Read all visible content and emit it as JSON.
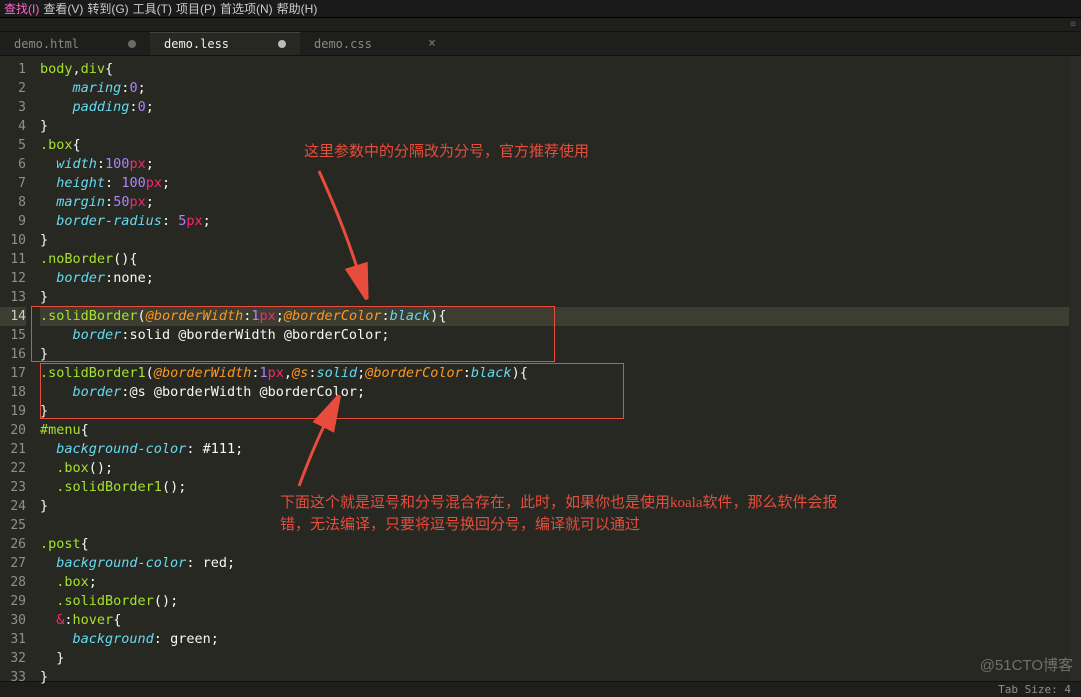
{
  "menubar": {
    "items": [
      "查找(I)",
      "查看(V)",
      "转到(G)",
      "工具(T)",
      "项目(P)",
      "首选项(N)",
      "帮助(H)"
    ]
  },
  "tabs": [
    {
      "label": "demo.html",
      "dirty": true,
      "active": false
    },
    {
      "label": "demo.less",
      "dirty": true,
      "active": true
    },
    {
      "label": "demo.css",
      "active": false,
      "close": true
    }
  ],
  "gutter": {
    "start": 1,
    "end": 33,
    "highlight": 14
  },
  "code": [
    [
      [
        "sel",
        "body"
      ],
      [
        "punct",
        ","
      ],
      [
        "sel",
        "div"
      ],
      [
        "punct",
        "{"
      ]
    ],
    [
      [
        "plain",
        "    "
      ],
      [
        "prop",
        "maring"
      ],
      [
        "punct",
        ":"
      ],
      [
        "num",
        "0"
      ],
      [
        "punct",
        ";"
      ]
    ],
    [
      [
        "plain",
        "    "
      ],
      [
        "prop",
        "padding"
      ],
      [
        "punct",
        ":"
      ],
      [
        "num",
        "0"
      ],
      [
        "punct",
        ";"
      ]
    ],
    [
      [
        "punct",
        "}"
      ]
    ],
    [
      [
        "sel",
        ".box"
      ],
      [
        "punct",
        "{"
      ]
    ],
    [
      [
        "plain",
        "  "
      ],
      [
        "prop",
        "width"
      ],
      [
        "punct",
        ":"
      ],
      [
        "num",
        "100"
      ],
      [
        "unit",
        "px"
      ],
      [
        "punct",
        ";"
      ]
    ],
    [
      [
        "plain",
        "  "
      ],
      [
        "prop",
        "height"
      ],
      [
        "punct",
        ": "
      ],
      [
        "num",
        "100"
      ],
      [
        "unit",
        "px"
      ],
      [
        "punct",
        ";"
      ]
    ],
    [
      [
        "plain",
        "  "
      ],
      [
        "prop",
        "margin"
      ],
      [
        "punct",
        ":"
      ],
      [
        "num",
        "50"
      ],
      [
        "unit",
        "px"
      ],
      [
        "punct",
        ";"
      ]
    ],
    [
      [
        "plain",
        "  "
      ],
      [
        "prop",
        "border-radius"
      ],
      [
        "punct",
        ": "
      ],
      [
        "num",
        "5"
      ],
      [
        "unit",
        "px"
      ],
      [
        "punct",
        ";"
      ]
    ],
    [
      [
        "punct",
        "}"
      ]
    ],
    [
      [
        "sel",
        ".noBorder"
      ],
      [
        "punct",
        "(){"
      ]
    ],
    [
      [
        "plain",
        "  "
      ],
      [
        "prop",
        "border"
      ],
      [
        "punct",
        ":"
      ],
      [
        "plain",
        "none"
      ],
      [
        "punct",
        ";"
      ]
    ],
    [
      [
        "punct",
        "}"
      ]
    ],
    [
      [
        "sel",
        ".solidBorder"
      ],
      [
        "punct",
        "("
      ],
      [
        "param",
        "@borderWidth"
      ],
      [
        "punct",
        ":"
      ],
      [
        "num",
        "1"
      ],
      [
        "unit",
        "px"
      ],
      [
        "punct",
        ";"
      ],
      [
        "param",
        "@borderColor"
      ],
      [
        "punct",
        ":"
      ],
      [
        "str",
        "black"
      ],
      [
        "punct",
        "){"
      ]
    ],
    [
      [
        "plain",
        "    "
      ],
      [
        "prop",
        "border"
      ],
      [
        "punct",
        ":"
      ],
      [
        "plain",
        "solid @borderWidth @borderColor"
      ],
      [
        "punct",
        ";"
      ]
    ],
    [
      [
        "punct",
        "}"
      ]
    ],
    [
      [
        "sel",
        ".solidBorder1"
      ],
      [
        "punct",
        "("
      ],
      [
        "param",
        "@borderWidth"
      ],
      [
        "punct",
        ":"
      ],
      [
        "num",
        "1"
      ],
      [
        "unit",
        "px"
      ],
      [
        "punct",
        ","
      ],
      [
        "param",
        "@s"
      ],
      [
        "punct",
        ":"
      ],
      [
        "str",
        "solid"
      ],
      [
        "punct",
        ";"
      ],
      [
        "param",
        "@borderColor"
      ],
      [
        "punct",
        ":"
      ],
      [
        "str",
        "black"
      ],
      [
        "punct",
        "){"
      ]
    ],
    [
      [
        "plain",
        "    "
      ],
      [
        "prop",
        "border"
      ],
      [
        "punct",
        ":"
      ],
      [
        "plain",
        "@s @borderWidth @borderColor"
      ],
      [
        "punct",
        ";"
      ]
    ],
    [
      [
        "punct",
        "}"
      ]
    ],
    [
      [
        "id",
        "#menu"
      ],
      [
        "punct",
        "{"
      ]
    ],
    [
      [
        "plain",
        "  "
      ],
      [
        "prop",
        "background-color"
      ],
      [
        "punct",
        ": "
      ],
      [
        "plain",
        "#111"
      ],
      [
        "punct",
        ";"
      ]
    ],
    [
      [
        "plain",
        "  "
      ],
      [
        "sel",
        ".box"
      ],
      [
        "punct",
        "();"
      ]
    ],
    [
      [
        "plain",
        "  "
      ],
      [
        "sel",
        ".solidBorder1"
      ],
      [
        "punct",
        "();"
      ]
    ],
    [
      [
        "punct",
        "}"
      ]
    ],
    [],
    [
      [
        "sel",
        ".post"
      ],
      [
        "punct",
        "{"
      ]
    ],
    [
      [
        "plain",
        "  "
      ],
      [
        "prop",
        "background-color"
      ],
      [
        "punct",
        ": "
      ],
      [
        "plain",
        "red"
      ],
      [
        "punct",
        ";"
      ]
    ],
    [
      [
        "plain",
        "  "
      ],
      [
        "sel",
        ".box"
      ],
      [
        "punct",
        ";"
      ]
    ],
    [
      [
        "plain",
        "  "
      ],
      [
        "sel",
        ".solidBorder"
      ],
      [
        "punct",
        "();"
      ]
    ],
    [
      [
        "plain",
        "  "
      ],
      [
        "kw",
        "&"
      ],
      [
        "punct",
        ":"
      ],
      [
        "fn",
        "hover"
      ],
      [
        "punct",
        "{"
      ]
    ],
    [
      [
        "plain",
        "    "
      ],
      [
        "prop",
        "background"
      ],
      [
        "punct",
        ": "
      ],
      [
        "plain",
        "green"
      ],
      [
        "punct",
        ";"
      ]
    ],
    [
      [
        "plain",
        "  "
      ],
      [
        "punct",
        "}"
      ]
    ],
    [
      [
        "punct",
        "}"
      ]
    ]
  ],
  "annotations": {
    "note1": "这里参数中的分隔改为分号，官方推荐使用",
    "note2_line1": "下面这个就是逗号和分号混合存在，此时，如果你也是使用koala软件，那么软件会报",
    "note2_line2": "错，无法编译，只要将逗号换回分号，编译就可以通过"
  },
  "statusbar": {
    "tab": "Tab Size: 4"
  },
  "watermark": "@51CTO博客"
}
